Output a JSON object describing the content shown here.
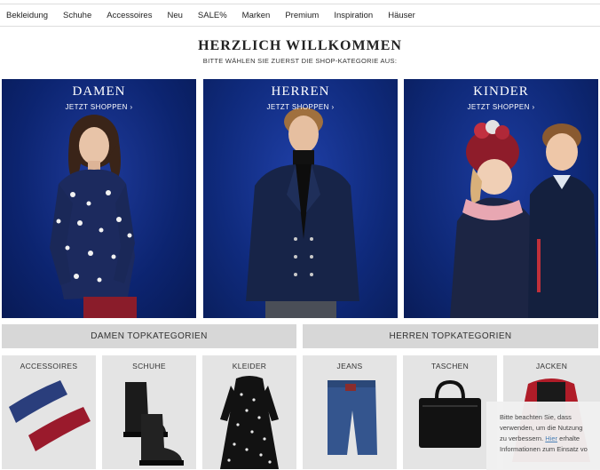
{
  "nav": {
    "items": [
      {
        "label": "Bekleidung"
      },
      {
        "label": "Schuhe"
      },
      {
        "label": "Accessoires"
      },
      {
        "label": "Neu"
      },
      {
        "label": "SALE%"
      },
      {
        "label": "Marken"
      },
      {
        "label": "Premium"
      },
      {
        "label": "Inspiration"
      },
      {
        "label": "Häuser"
      }
    ]
  },
  "hero": {
    "title": "HERZLICH WILLKOMMEN",
    "subtitle": "BITTE WÄHLEN SIE ZUERST DIE SHOP-KATEGORIE AUS:"
  },
  "categories": [
    {
      "title": "DAMEN",
      "cta": "JETZT SHOPPEN ›"
    },
    {
      "title": "HERREN",
      "cta": "JETZT SHOPPEN ›"
    },
    {
      "title": "KINDER",
      "cta": "JETZT SHOPPEN ›"
    }
  ],
  "topcategories": {
    "damen": "DAMEN TOPKATEGORIEN",
    "herren": "HERREN TOPKATEGORIEN"
  },
  "products": [
    {
      "label": "ACCESSOIRES"
    },
    {
      "label": "SCHUHE"
    },
    {
      "label": "KLEIDER"
    },
    {
      "label": "JEANS"
    },
    {
      "label": "TASCHEN"
    },
    {
      "label": "JACKEN"
    }
  ],
  "cookie": {
    "line1": "Bitte beachten Sie, dass",
    "line2": "verwenden, um die Nutzung",
    "line3_pre": "zu verbessern.",
    "link": "Hier",
    "line3_post": "erhalte",
    "line4": "Informationen zum Einsatz vo"
  },
  "colors": {
    "tile_blue": "#0c2470",
    "topcat_gray": "#d7d7d7",
    "product_gray": "#e4e4e4"
  }
}
